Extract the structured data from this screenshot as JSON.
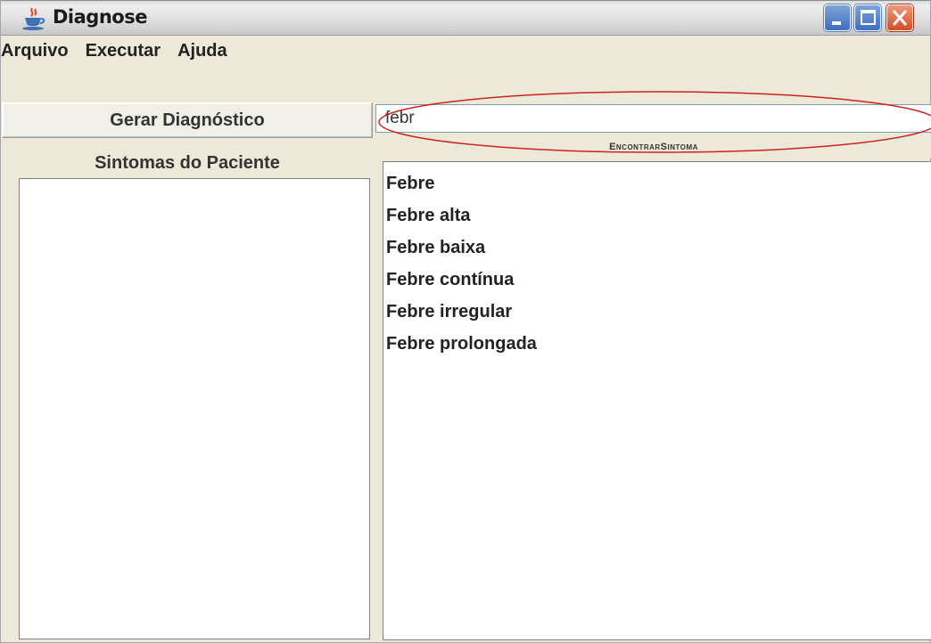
{
  "window": {
    "title": "Diagnose"
  },
  "menu": {
    "items": [
      "Arquivo",
      "Executar",
      "Ajuda"
    ]
  },
  "left_panel": {
    "generate_button": "Gerar Diagnóstico",
    "symptoms_label": "Sintomas do Paciente",
    "symptoms": []
  },
  "right_panel": {
    "search_value": "febr",
    "find_button": "EncontrarSintoma",
    "results": [
      "Febre",
      "Febre alta",
      "Febre baixa",
      "Febre contínua",
      "Febre irregular",
      "Febre prolongada"
    ]
  },
  "icons": {
    "app": "java-coffee-icon",
    "minimize": "minimize-icon",
    "maximize": "maximize-icon",
    "close": "close-icon"
  },
  "colors": {
    "highlight_ellipse": "#cc2222",
    "close_button": "#d34d25",
    "window_buttons": "#3d6ec4"
  }
}
